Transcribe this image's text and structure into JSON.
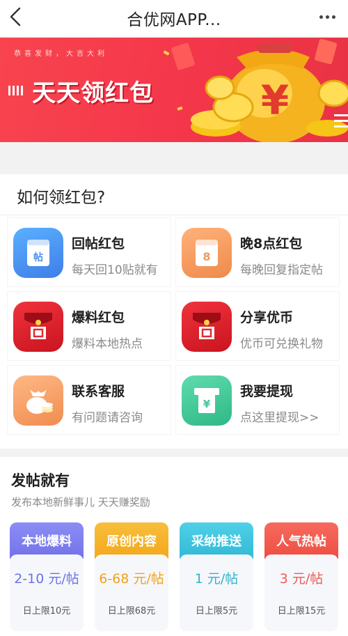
{
  "header": {
    "title": "合优网APP..."
  },
  "banner": {
    "motto": "恭喜发财，大吉大利",
    "title": "天天领红包",
    "coin_symbol": "¥"
  },
  "how_to": {
    "title": "如何领红包?",
    "items": [
      {
        "title": "回帖红包",
        "subtitle": "每天回10贴就有",
        "icon": "reply-envelope-icon",
        "icon_glyph": "帖",
        "color": "#4a8ff2"
      },
      {
        "title": "晚8点红包",
        "subtitle": "每晚回复指定帖",
        "icon": "evening-envelope-icon",
        "icon_glyph": "8",
        "color": "#f0995a"
      },
      {
        "title": "爆料红包",
        "subtitle": "爆料本地热点",
        "icon": "red-envelope-icon",
        "icon_glyph": "回",
        "color": "#e02a34"
      },
      {
        "title": "分享优币",
        "subtitle": "优币可兑换礼物",
        "icon": "red-envelope-icon",
        "icon_glyph": "回",
        "color": "#e02a34"
      },
      {
        "title": "联系客服",
        "subtitle": "有问题请咨询",
        "icon": "money-bag-icon",
        "icon_glyph": "$",
        "color": "#f2a15c"
      },
      {
        "title": "我要提现",
        "subtitle": "点这里提现>>",
        "icon": "withdraw-icon",
        "icon_glyph": "¥",
        "color": "#43c79a"
      }
    ]
  },
  "post_section": {
    "title": "发帖就有",
    "subtitle": "发布本地新鲜事儿 天天赚奖励",
    "rewards": [
      {
        "label": "本地爆料",
        "amount": "2-10 元/帖",
        "limit": "日上限10元",
        "color": "#7f7ef0",
        "amount_color": "#6c73e6"
      },
      {
        "label": "原创内容",
        "amount": "6-68 元/帖",
        "limit": "日上限68元",
        "color": "#f5b12a",
        "amount_color": "#f0a21b"
      },
      {
        "label": "采纳推送",
        "amount": "1 元/帖",
        "limit": "日上限5元",
        "color": "#3cc2dc",
        "amount_color": "#2fb4cf"
      },
      {
        "label": "人气热帖",
        "amount": "3 元/帖",
        "limit": "日上限15元",
        "color": "#f25a4e",
        "amount_color": "#ef5a52"
      }
    ]
  }
}
